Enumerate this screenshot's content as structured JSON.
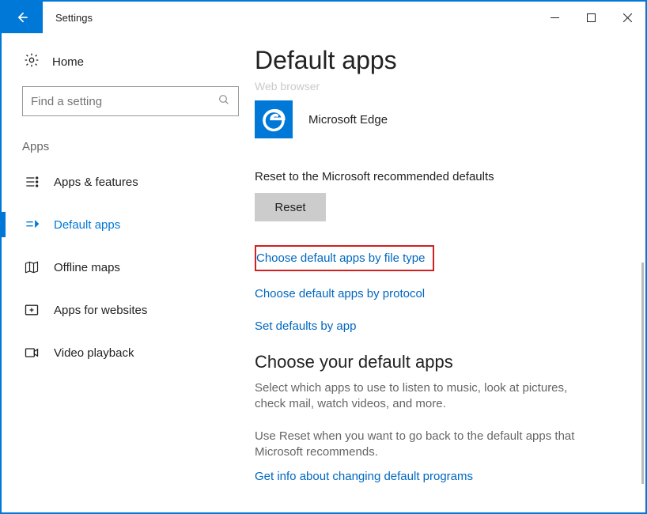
{
  "window": {
    "title": "Settings"
  },
  "sidebar": {
    "home": "Home",
    "search_placeholder": "Find a setting",
    "category": "Apps",
    "items": [
      {
        "label": "Apps & features"
      },
      {
        "label": "Default apps"
      },
      {
        "label": "Offline maps"
      },
      {
        "label": "Apps for websites"
      },
      {
        "label": "Video playback"
      }
    ],
    "active_index": 1
  },
  "main": {
    "heading": "Default apps",
    "web_browser_label": "Web browser",
    "browser_app": "Microsoft Edge",
    "reset_text": "Reset to the Microsoft recommended defaults",
    "reset_button": "Reset",
    "links": [
      "Choose default apps by file type",
      "Choose default apps by protocol",
      "Set defaults by app"
    ],
    "highlighted_link_index": 0,
    "choose_heading": "Choose your default apps",
    "choose_p1": "Select which apps to use to listen to music, look at pictures, check mail, watch videos, and more.",
    "choose_p2": "Use Reset when you want to go back to the default apps that Microsoft recommends.",
    "info_link": "Get info about changing default programs"
  }
}
